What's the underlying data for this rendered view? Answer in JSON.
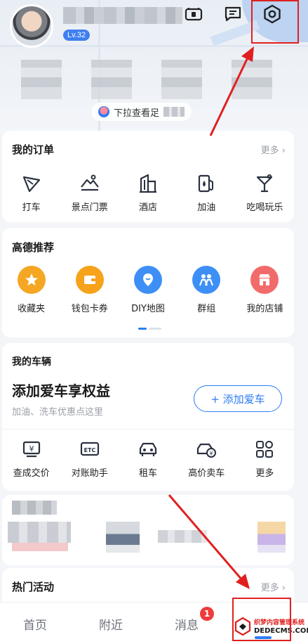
{
  "header": {
    "level": "Lv.32",
    "pull_tip": "下拉查看足"
  },
  "orders": {
    "title": "我的订单",
    "more": "更多",
    "items": [
      {
        "label": "打车",
        "icon": "taxi-flag-icon"
      },
      {
        "label": "景点门票",
        "icon": "scenic-ticket-icon"
      },
      {
        "label": "酒店",
        "icon": "hotel-building-icon"
      },
      {
        "label": "加油",
        "icon": "fuel-pump-icon"
      },
      {
        "label": "吃喝玩乐",
        "icon": "cocktail-icon"
      }
    ]
  },
  "recommend": {
    "title": "高德推荐",
    "items": [
      {
        "label": "收藏夹",
        "icon": "star-icon",
        "color": "#f5a623"
      },
      {
        "label": "钱包卡券",
        "icon": "wallet-icon",
        "color": "#f6a21b"
      },
      {
        "label": "DIY地图",
        "icon": "diy-map-icon",
        "color": "#3d8ff5"
      },
      {
        "label": "群组",
        "icon": "group-icon",
        "color": "#3d8ff5"
      },
      {
        "label": "我的店铺",
        "icon": "shop-icon",
        "color": "#f26b6b"
      }
    ]
  },
  "vehicles": {
    "title": "我的车辆",
    "headline": "添加爱车享权益",
    "subtitle": "加油、洗车优惠点这里",
    "add_button": "+ 添加爱车",
    "items": [
      {
        "label": "查成交价",
        "icon": "price-tag-icon"
      },
      {
        "label": "对账助手",
        "icon": "etc-icon"
      },
      {
        "label": "租车",
        "icon": "rent-car-icon"
      },
      {
        "label": "高价卖车",
        "icon": "sell-car-icon"
      },
      {
        "label": "更多",
        "icon": "grid-more-icon"
      }
    ]
  },
  "activities": {
    "title": "热门活动",
    "more": "更多"
  },
  "nav": {
    "tabs": [
      {
        "label": "首页"
      },
      {
        "label": "附近"
      },
      {
        "label": "消息"
      }
    ],
    "message_badge": "1"
  },
  "watermark": {
    "line1": "织梦内容管理系统",
    "line2": "DEDECMS.COM"
  },
  "colors": {
    "accent": "#2d7cf6",
    "annotation": "#e02020",
    "badge": "#ef3b3b"
  }
}
